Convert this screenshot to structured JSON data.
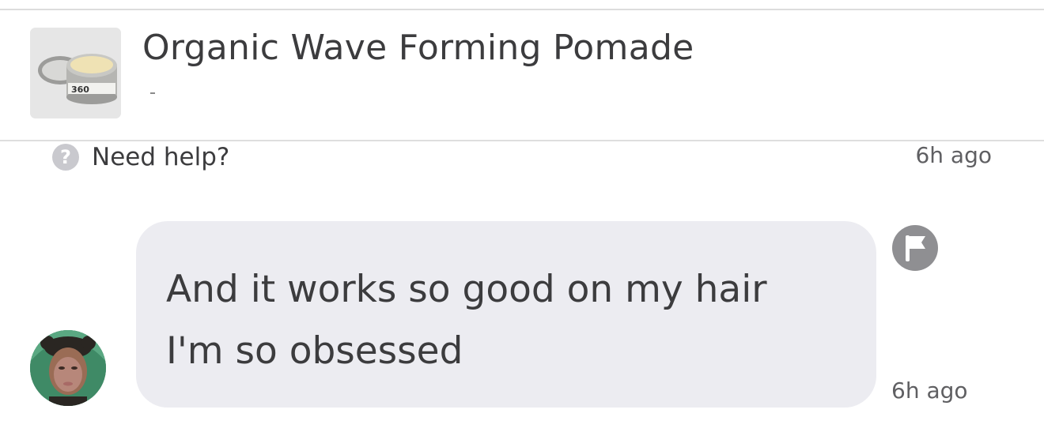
{
  "product": {
    "title": "Organic Wave Forming Pomade",
    "thumbnail_icon": "pomade-tin-image",
    "tin_label": "360"
  },
  "help": {
    "label": "Need help?",
    "icon": "question-mark-icon",
    "icon_glyph": "?",
    "timestamp": "6h ago"
  },
  "message": {
    "text": "And it works so good on my hair\nI'm so obsessed",
    "timestamp": "6h ago",
    "flag_icon": "flag-icon",
    "avatar": "user-avatar"
  },
  "colors": {
    "bubble": "#ececf1",
    "text": "#3c3c3e",
    "muted": "#5f5f62",
    "icon_gray": "#c9c9ce",
    "flag_gray": "#8f8f92"
  }
}
